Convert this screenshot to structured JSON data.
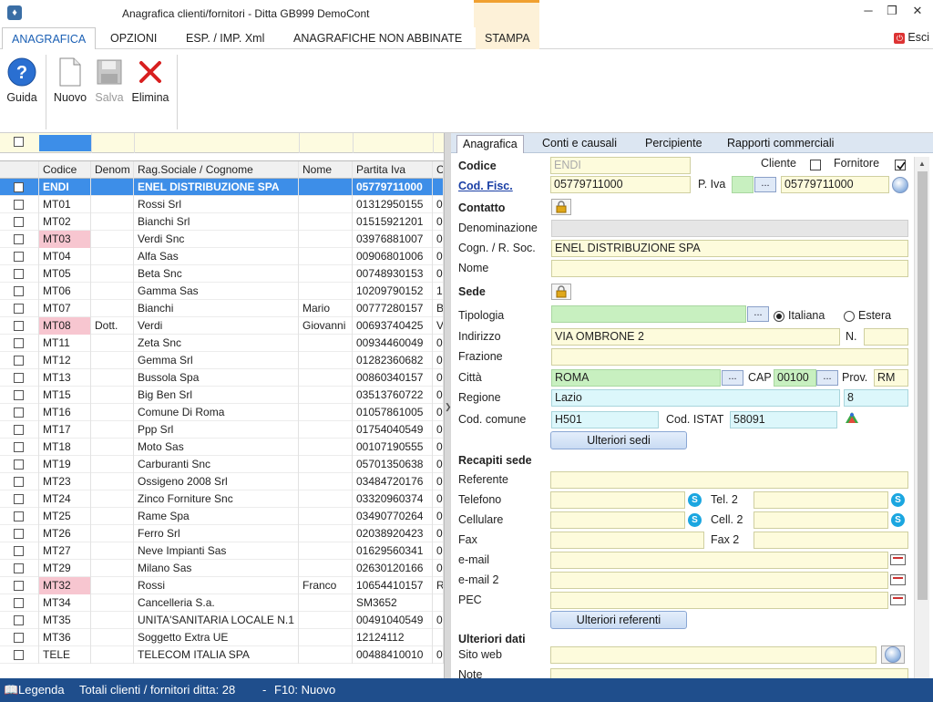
{
  "window": {
    "title": "Anagrafica clienti/fornitori - Ditta GB999 DemoCont"
  },
  "menu": {
    "items": [
      "ANAGRAFICA",
      "OPZIONI",
      "ESP. / IMP. Xml",
      "ANAGRAFICHE NON ABBINATE",
      "STAMPA"
    ],
    "exit": "Esci"
  },
  "toolbar": {
    "guida": "Guida",
    "nuovo": "Nuovo",
    "salva": "Salva",
    "elimina": "Elimina"
  },
  "grid": {
    "headers": [
      "Codice",
      "Denom",
      "Rag.Sociale / Cognome",
      "Nome",
      "Partita Iva",
      "C"
    ],
    "rows": [
      {
        "codice": "ENDI",
        "denom": "",
        "rag": "ENEL DISTRIBUZIONE SPA",
        "nome": "",
        "piva": "05779711000",
        "c": ""
      },
      {
        "codice": "MT01",
        "denom": "",
        "rag": "Rossi Srl",
        "nome": "",
        "piva": "01312950155",
        "c": "0"
      },
      {
        "codice": "MT02",
        "denom": "",
        "rag": "Bianchi Srl",
        "nome": "",
        "piva": "01515921201",
        "c": "0"
      },
      {
        "codice": "MT03",
        "denom": "",
        "rag": "Verdi Snc",
        "nome": "",
        "piva": "03976881007",
        "c": "0"
      },
      {
        "codice": "MT04",
        "denom": "",
        "rag": "Alfa Sas",
        "nome": "",
        "piva": "00906801006",
        "c": "0"
      },
      {
        "codice": "MT05",
        "denom": "",
        "rag": "Beta Snc",
        "nome": "",
        "piva": "00748930153",
        "c": "0"
      },
      {
        "codice": "MT06",
        "denom": "",
        "rag": "Gamma Sas",
        "nome": "",
        "piva": "10209790152",
        "c": "1"
      },
      {
        "codice": "MT07",
        "denom": "",
        "rag": "Bianchi",
        "nome": "Mario",
        "piva": "00777280157",
        "c": "B"
      },
      {
        "codice": "MT08",
        "denom": "Dott.",
        "rag": "Verdi",
        "nome": "Giovanni",
        "piva": "00693740425",
        "c": "V"
      },
      {
        "codice": "MT11",
        "denom": "",
        "rag": "Zeta Snc",
        "nome": "",
        "piva": "00934460049",
        "c": "0"
      },
      {
        "codice": "MT12",
        "denom": "",
        "rag": "Gemma Srl",
        "nome": "",
        "piva": "01282360682",
        "c": "0"
      },
      {
        "codice": "MT13",
        "denom": "",
        "rag": "Bussola Spa",
        "nome": "",
        "piva": "00860340157",
        "c": "0"
      },
      {
        "codice": "MT15",
        "denom": "",
        "rag": "Big Ben Srl",
        "nome": "",
        "piva": "03513760722",
        "c": "0"
      },
      {
        "codice": "MT16",
        "denom": "",
        "rag": "Comune Di Roma",
        "nome": "",
        "piva": "01057861005",
        "c": "0"
      },
      {
        "codice": "MT17",
        "denom": "",
        "rag": "Ppp Srl",
        "nome": "",
        "piva": "01754040549",
        "c": "0"
      },
      {
        "codice": "MT18",
        "denom": "",
        "rag": "Moto Sas",
        "nome": "",
        "piva": "00107190555",
        "c": "0"
      },
      {
        "codice": "MT19",
        "denom": "",
        "rag": "Carburanti Snc",
        "nome": "",
        "piva": "05701350638",
        "c": "0"
      },
      {
        "codice": "MT23",
        "denom": "",
        "rag": "Ossigeno 2008 Srl",
        "nome": "",
        "piva": "03484720176",
        "c": "0"
      },
      {
        "codice": "MT24",
        "denom": "",
        "rag": "Zinco Forniture Snc",
        "nome": "",
        "piva": "03320960374",
        "c": "0"
      },
      {
        "codice": "MT25",
        "denom": "",
        "rag": "Rame Spa",
        "nome": "",
        "piva": "03490770264",
        "c": "0"
      },
      {
        "codice": "MT26",
        "denom": "",
        "rag": "Ferro Srl",
        "nome": "",
        "piva": "02038920423",
        "c": "0"
      },
      {
        "codice": "MT27",
        "denom": "",
        "rag": "Neve Impianti Sas",
        "nome": "",
        "piva": "01629560341",
        "c": "0"
      },
      {
        "codice": "MT29",
        "denom": "",
        "rag": "Milano Sas",
        "nome": "",
        "piva": "02630120166",
        "c": "0"
      },
      {
        "codice": "MT32",
        "denom": "",
        "rag": "Rossi",
        "nome": "Franco",
        "piva": "10654410157",
        "c": "R"
      },
      {
        "codice": "MT34",
        "denom": "",
        "rag": "Cancelleria S.a.",
        "nome": "",
        "piva": "SM3652",
        "c": ""
      },
      {
        "codice": "MT35",
        "denom": "",
        "rag": "UNITA'SANITARIA LOCALE N.1",
        "nome": "",
        "piva": "00491040549",
        "c": "0"
      },
      {
        "codice": "MT36",
        "denom": "",
        "rag": "Soggetto Extra UE",
        "nome": "",
        "piva": "12124112",
        "c": ""
      },
      {
        "codice": "TELE",
        "denom": "",
        "rag": "TELECOM ITALIA SPA",
        "nome": "",
        "piva": "00488410010",
        "c": "0"
      }
    ]
  },
  "tabs": [
    "Anagrafica",
    "Conti e causali",
    "Percipiente",
    "Rapporti commerciali"
  ],
  "form": {
    "codice_label": "Codice",
    "codice_value": "ENDI",
    "cliente_label": "Cliente",
    "fornitore_label": "Fornitore",
    "codfisc_label": "Cod. Fisc.",
    "codfisc_value": "05779711000",
    "piva_label": "P. Iva",
    "piva_value": "05779711000",
    "contatto_label": "Contatto",
    "denominazione_label": "Denominazione",
    "cognome_label": "Cogn. / R. Soc.",
    "cognome_value": "ENEL DISTRIBUZIONE SPA",
    "nome_label": "Nome",
    "sede_label": "Sede",
    "tipologia_label": "Tipologia",
    "italiana_label": "Italiana",
    "estera_label": "Estera",
    "indirizzo_label": "Indirizzo",
    "indirizzo_value": "VIA OMBRONE 2",
    "n_label": "N.",
    "frazione_label": "Frazione",
    "citta_label": "Città",
    "citta_value": "ROMA",
    "cap_label": "CAP",
    "cap_value": "00100",
    "prov_label": "Prov.",
    "prov_value": "RM",
    "regione_label": "Regione",
    "regione_value": "Lazio",
    "regione_code": "8",
    "codcomune_label": "Cod. comune",
    "codcomune_value": "H501",
    "istat_label": "Cod. ISTAT",
    "istat_value": "58091",
    "ulteriori_sedi": "Ulteriori sedi",
    "recapiti_label": "Recapiti sede",
    "referente_label": "Referente",
    "telefono_label": "Telefono",
    "tel2_label": "Tel. 2",
    "cellulare_label": "Cellulare",
    "cell2_label": "Cell. 2",
    "fax_label": "Fax",
    "fax2_label": "Fax 2",
    "email_label": "e-mail",
    "email2_label": "e-mail 2",
    "pec_label": "PEC",
    "ulteriori_referenti": "Ulteriori referenti",
    "ulteriori_dati_label": "Ulteriori dati",
    "sitoweb_label": "Sito web",
    "note_label": "Note"
  },
  "status": {
    "legenda": "Legenda",
    "totali": "Totali clienti / fornitori ditta: 28",
    "sep": "-",
    "f10": "F10: Nuovo"
  }
}
